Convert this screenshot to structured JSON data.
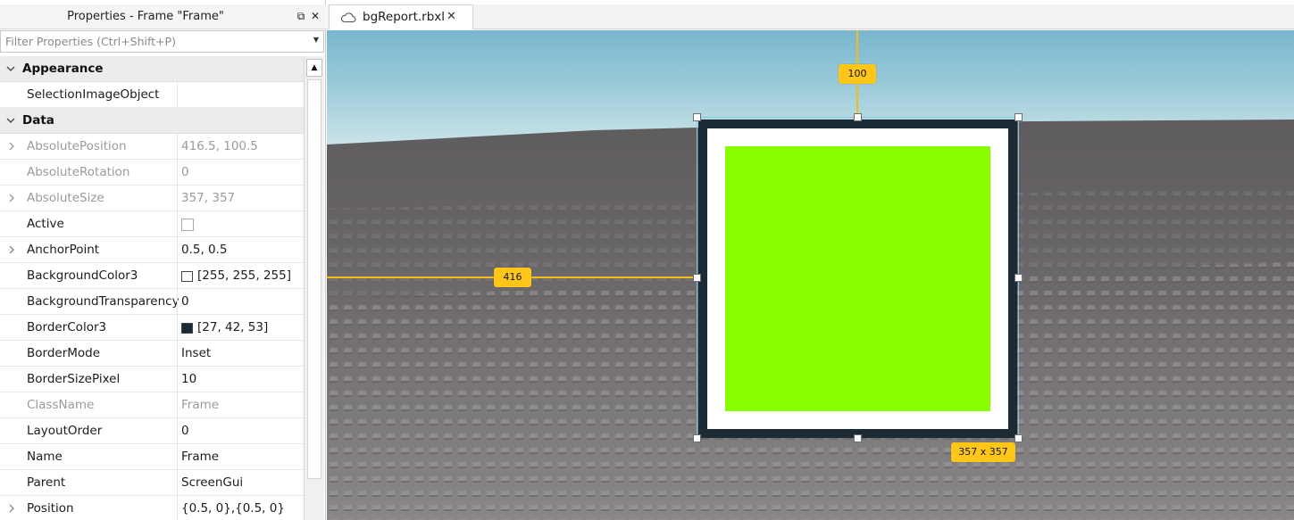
{
  "properties_panel": {
    "title": "Properties - Frame \"Frame\"",
    "float_icon": "⧉",
    "close_icon": "✕",
    "filter_placeholder": "Filter Properties (Ctrl+Shift+P)",
    "categories": [
      {
        "label": "Appearance"
      },
      {
        "label": "Data"
      }
    ],
    "rows": {
      "selection_image_object": {
        "name": "SelectionImageObject",
        "value": ""
      },
      "absolute_position": {
        "name": "AbsolutePosition",
        "value": "416.5, 100.5"
      },
      "absolute_rotation": {
        "name": "AbsoluteRotation",
        "value": "0"
      },
      "absolute_size": {
        "name": "AbsoluteSize",
        "value": "357, 357"
      },
      "active": {
        "name": "Active",
        "value": false
      },
      "anchor_point": {
        "name": "AnchorPoint",
        "value": "0.5, 0.5"
      },
      "background_color3": {
        "name": "BackgroundColor3",
        "value": "[255, 255, 255]",
        "swatch": "#ffffff"
      },
      "background_transparency": {
        "name": "BackgroundTransparency",
        "value": "0"
      },
      "border_color3": {
        "name": "BorderColor3",
        "value": "[27, 42, 53]",
        "swatch": "#1b2a35"
      },
      "border_mode": {
        "name": "BorderMode",
        "value": "Inset"
      },
      "border_size_pixel": {
        "name": "BorderSizePixel",
        "value": "10"
      },
      "class_name": {
        "name": "ClassName",
        "value": "Frame"
      },
      "layout_order": {
        "name": "LayoutOrder",
        "value": "0"
      },
      "name": {
        "name": "Name",
        "value": "Frame"
      },
      "parent": {
        "name": "Parent",
        "value": "ScreenGui"
      },
      "position": {
        "name": "Position",
        "value": "{0.5, 0},{0.5, 0}"
      }
    }
  },
  "tabs": [
    {
      "label": "bgReport.rbxl",
      "icon": "cloud-icon",
      "close": "✕"
    }
  ],
  "viewport": {
    "top_offset_label": "100",
    "left_offset_label": "416",
    "size_label": "357 x 357",
    "guide_color": "#f3bd18",
    "badge_color": "#ffc61a",
    "frame_border_color": "#1b2a35",
    "frame_background_color": "#ffffff",
    "child_color": "#88ff00"
  }
}
